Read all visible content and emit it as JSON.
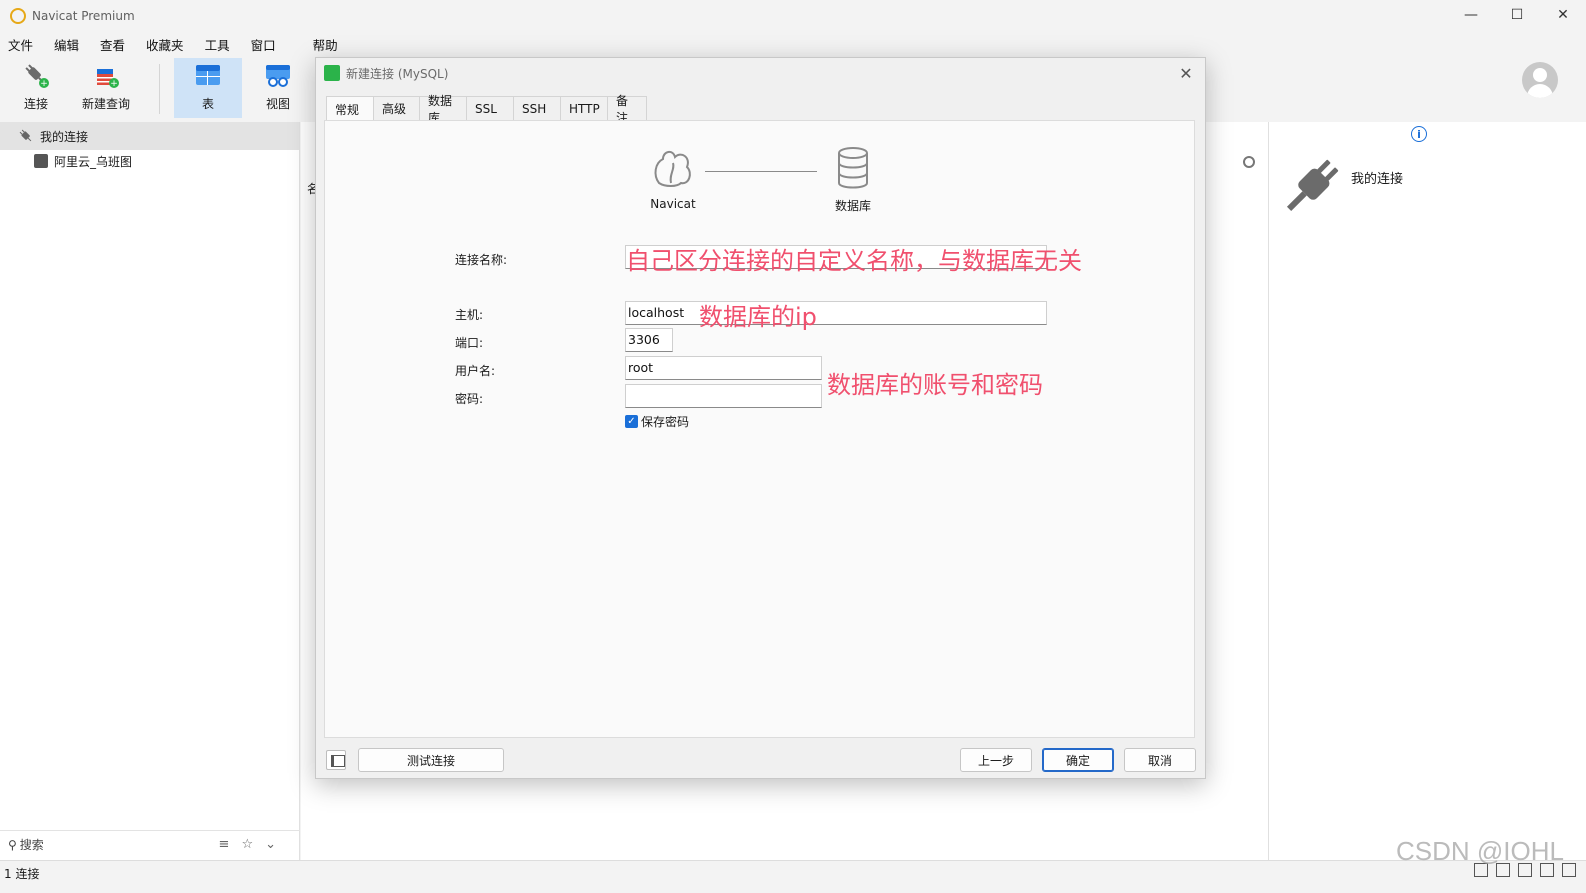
{
  "window": {
    "title": "Navicat Premium",
    "minimize": "—",
    "maximize": "☐",
    "close": "✕"
  },
  "menu": [
    "文件",
    "编辑",
    "查看",
    "收藏夹",
    "工具",
    "窗口",
    "帮助"
  ],
  "toolbar": {
    "connect": "连接",
    "new_query": "新建查询",
    "table": "表",
    "view": "视图"
  },
  "sidebar": {
    "root": "我的连接",
    "child": "阿里云_乌班图",
    "search_placeholder": "搜索"
  },
  "center": {
    "column_header_partial": "名"
  },
  "right_panel": {
    "title": "我的连接",
    "info": "i"
  },
  "dialog": {
    "title": "新建连接 (MySQL)",
    "tabs": [
      "常规",
      "高级",
      "数据库",
      "SSL",
      "SSH",
      "HTTP",
      "备注"
    ],
    "active_tab": "常规",
    "diagram": {
      "left": "Navicat",
      "right": "数据库"
    },
    "labels": {
      "conn_name": "连接名称:",
      "host": "主机:",
      "port": "端口:",
      "user": "用户名:",
      "password": "密码:"
    },
    "values": {
      "conn_name": "",
      "host": "localhost",
      "port": "3306",
      "user": "root",
      "password": ""
    },
    "save_password": "保存密码",
    "save_password_checked": true,
    "buttons": {
      "test": "测试连接",
      "back": "上一步",
      "ok": "确定",
      "cancel": "取消"
    }
  },
  "annotations": {
    "conn_name": "自己区分连接的自定义名称，与数据库无关",
    "host": "数据库的ip",
    "account": "数据库的账号和密码"
  },
  "status": {
    "text": "1 连接"
  },
  "watermark": "CSDN @IOHL",
  "colors": {
    "annotation": "#f0506e",
    "accent": "#1a6fd8",
    "active_tool": "#cfe3f7"
  }
}
